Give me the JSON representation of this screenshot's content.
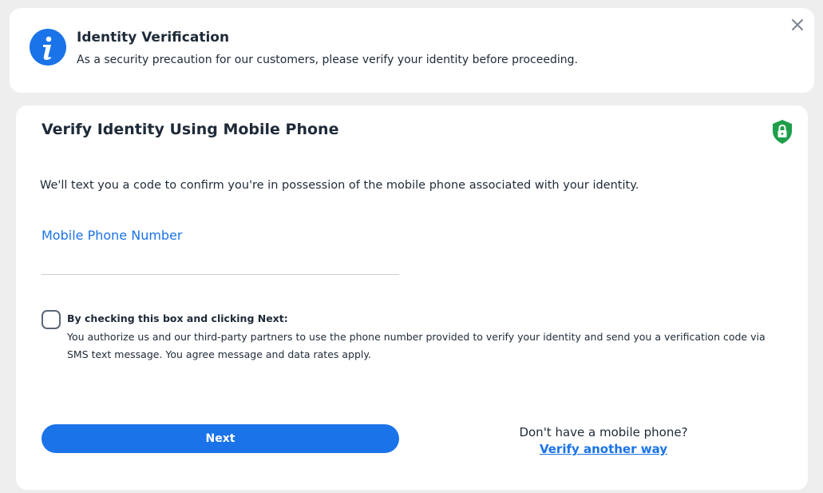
{
  "banner": {
    "icon": "info-icon",
    "title": "Identity Verification",
    "text": "As a security precaution for our customers, please verify your identity before proceeding.",
    "close_icon": "close-icon"
  },
  "card": {
    "title": "Verify Identity Using Mobile Phone",
    "badge_icon": "shield-lock-icon",
    "description": "We'll text you a code to confirm you're in possession of the mobile phone associated with your identity.",
    "phone_field": {
      "label": "Mobile Phone Number",
      "value": "",
      "placeholder": ""
    },
    "consent": {
      "checked": false,
      "title": "By checking this box and clicking Next:",
      "body": "You authorize us and our third-party partners to use the phone number provided to verify your identity and send you a verification code via SMS text message. You agree message and data rates apply."
    },
    "next_label": "Next",
    "alt_text": "Don't have a mobile phone?",
    "alt_link": "Verify another way"
  },
  "colors": {
    "accent": "#1a73e8",
    "success": "#1e9e4a",
    "text": "#1e2a38",
    "background": "#eeeeee"
  }
}
